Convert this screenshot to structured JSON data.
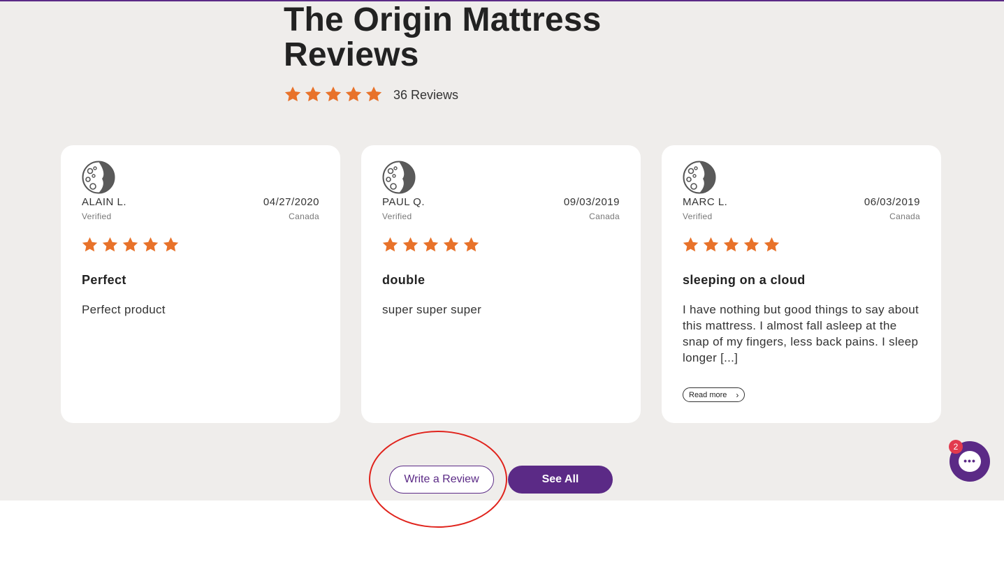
{
  "page": {
    "title": "The Origin Mattress Reviews",
    "review_count": "36 Reviews",
    "rating_stars": 5
  },
  "colors": {
    "star": "#e8722a",
    "brand_purple": "#5b2a86",
    "section_bg": "#efedeb",
    "highlight": "#e0231c"
  },
  "reviews": [
    {
      "name": "ALAIN L.",
      "verified": "Verified",
      "date": "04/27/2020",
      "country": "Canada",
      "stars": 5,
      "headline": "Perfect",
      "body": "Perfect product",
      "read_more": ""
    },
    {
      "name": "PAUL Q.",
      "verified": "Verified",
      "date": "09/03/2019",
      "country": "Canada",
      "stars": 5,
      "headline": "double",
      "body": "super super super",
      "read_more": ""
    },
    {
      "name": "MARC L.",
      "verified": "Verified",
      "date": "06/03/2019",
      "country": "Canada",
      "stars": 5,
      "headline": "sleeping on a cloud",
      "body": "I have nothing but good things to say about this mattress. I almost fall asleep at the snap of my fingers, less back pains. I sleep longer [...]",
      "read_more": "Read more"
    }
  ],
  "actions": {
    "write_review": "Write a Review",
    "see_all": "See All"
  },
  "chat": {
    "badge_count": "2",
    "icon": "chat-dots-icon"
  }
}
